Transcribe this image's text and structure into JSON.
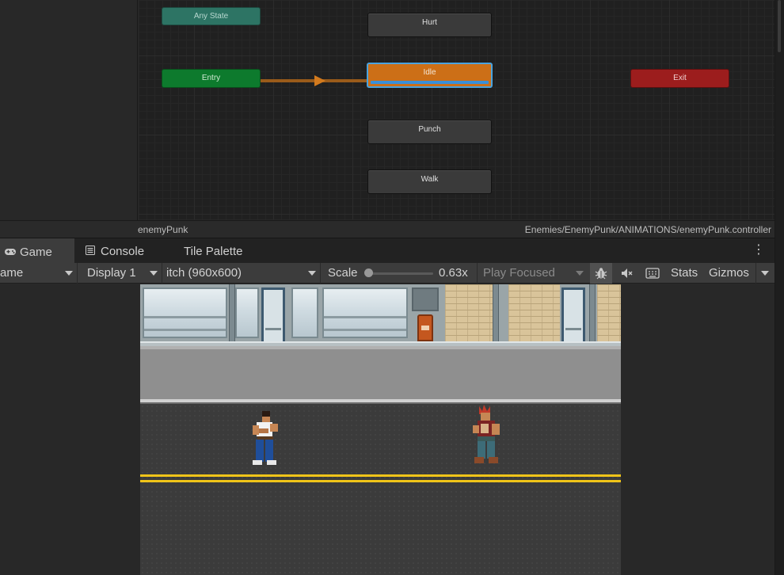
{
  "animator": {
    "states": {
      "any_state": "Any State",
      "entry": "Entry",
      "exit": "Exit",
      "hurt": "Hurt",
      "idle": "Idle",
      "punch": "Punch",
      "walk": "Walk"
    },
    "footer": {
      "controller_name": "enemyPunk",
      "controller_path": "Enemies/EnemyPunk/ANIMATIONS/enemyPunk.controller"
    }
  },
  "tabs": [
    {
      "label": "Game",
      "icon": "gamepad-icon"
    },
    {
      "label": "Console",
      "icon": "console-icon"
    },
    {
      "label": "Tile Palette",
      "icon": ""
    }
  ],
  "toolbar": {
    "mode": "ame",
    "display": "Display 1",
    "resolution": "itch (960x600)",
    "scale_label": "Scale",
    "scale_value": "0.63x",
    "play_mode": "Play Focused",
    "stats": "Stats",
    "gizmos": "Gizmos",
    "icons": [
      "bug-icon",
      "mute-audio-icon",
      "keyboard-icon"
    ]
  },
  "colors": {
    "idle_state": "#cc6f17",
    "entry_state": "#0d7a2d",
    "exit_state": "#9c1d1d",
    "any_state": "#2d7464",
    "selection": "#4aa3df",
    "lane_line": "#f0c419"
  }
}
